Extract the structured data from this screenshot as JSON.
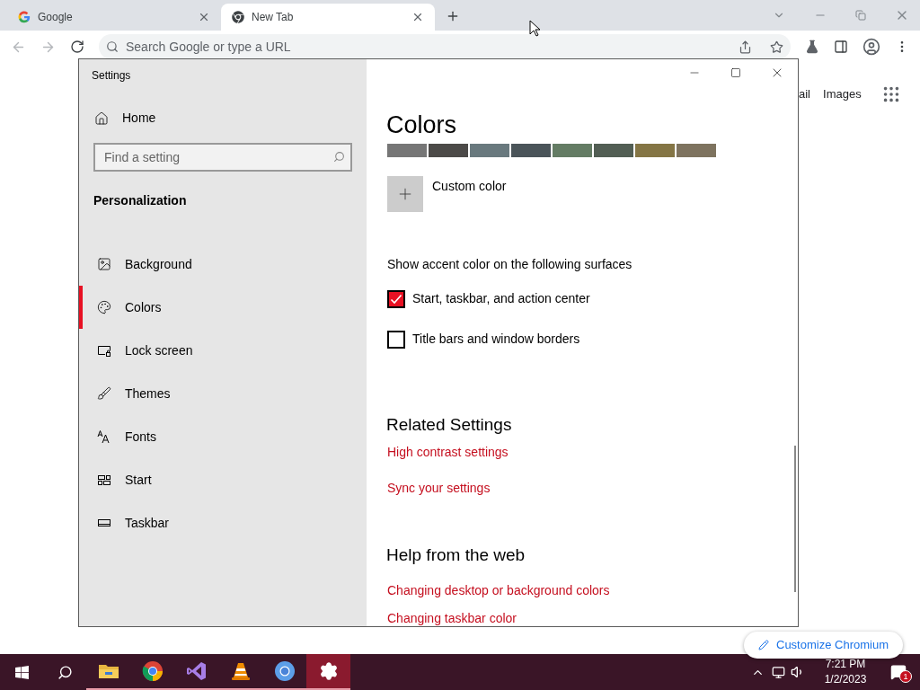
{
  "browser": {
    "tabs": [
      {
        "title": "Google",
        "selected": false,
        "kind": "google"
      },
      {
        "title": "New Tab",
        "selected": true,
        "kind": "chromium"
      }
    ],
    "address": {
      "placeholder": "Search Google or type a URL"
    },
    "page": {
      "links": [
        "ail",
        "Images"
      ],
      "customize_button": "Customize Chromium"
    }
  },
  "settings": {
    "title": "Settings",
    "home": "Home",
    "search": {
      "placeholder": "Find a setting"
    },
    "section": "Personalization",
    "nav": [
      {
        "label": "Background",
        "selected": false,
        "kind": "image"
      },
      {
        "label": "Colors",
        "selected": true,
        "kind": "palette"
      },
      {
        "label": "Lock screen",
        "selected": false,
        "kind": "lock"
      },
      {
        "label": "Themes",
        "selected": false,
        "kind": "brush"
      },
      {
        "label": "Fonts",
        "selected": false,
        "kind": "fonts"
      },
      {
        "label": "Start",
        "selected": false,
        "kind": "start"
      },
      {
        "label": "Taskbar",
        "selected": false,
        "kind": "taskbar"
      }
    ],
    "heading": "Colors",
    "swatches": [
      {
        "color": "#767676"
      },
      {
        "color": "#4c4a48"
      },
      {
        "color": "#69797e"
      },
      {
        "color": "#4a5459"
      },
      {
        "color": "#647c64"
      },
      {
        "color": "#525e54"
      },
      {
        "color": "#847545"
      },
      {
        "color": "#7e735f"
      }
    ],
    "custom_color": "Custom color",
    "accent_label": "Show accent color on the following surfaces",
    "checkboxes": [
      {
        "label": "Start, taskbar, and action center",
        "checked": true
      },
      {
        "label": "Title bars and window borders",
        "checked": false
      }
    ],
    "related": {
      "heading": "Related Settings",
      "links": [
        "High contrast settings",
        "Sync your settings"
      ]
    },
    "help": {
      "heading": "Help from the web",
      "links": [
        "Changing desktop or background colors",
        "Changing taskbar color"
      ]
    }
  },
  "taskbar": {
    "apps": [
      {
        "kind": "folder",
        "selected": false
      },
      {
        "kind": "chrome",
        "selected": false
      },
      {
        "kind": "visualstudio",
        "selected": false
      },
      {
        "kind": "vlc",
        "selected": false
      },
      {
        "kind": "chromium",
        "selected": false
      },
      {
        "kind": "settings",
        "selected": true
      }
    ],
    "time": "7:21 PM",
    "date": "1/2/2023",
    "notifications": "1"
  }
}
